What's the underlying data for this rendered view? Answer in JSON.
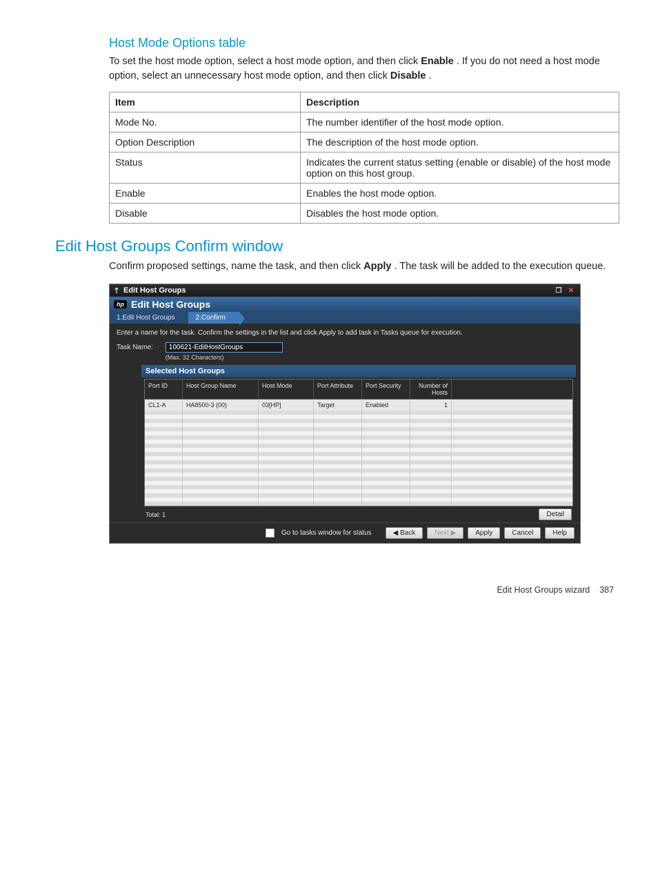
{
  "section1": {
    "heading": "Host Mode Options table",
    "intro_pre": "To set the host mode option, select a host mode option, and then click ",
    "intro_b1": "Enable",
    "intro_mid": ". If you do not need a host mode option, select an unnecessary host mode option, and then click ",
    "intro_b2": "Disable",
    "intro_post": "."
  },
  "opts_table": {
    "head_item": "Item",
    "head_desc": "Description",
    "rows": [
      {
        "item": "Mode No.",
        "desc": "The number identifier of the host mode option."
      },
      {
        "item": "Option Description",
        "desc": "The description of the host mode option."
      },
      {
        "item": "Status",
        "desc": "Indicates the current status setting (enable or disable) of the host mode option on this host group."
      },
      {
        "item": "Enable",
        "desc": "Enables the host mode option."
      },
      {
        "item": "Disable",
        "desc": "Disables the host mode option."
      }
    ]
  },
  "section2": {
    "heading": "Edit Host Groups Confirm window",
    "intro_pre": "Confirm proposed settings, name the task, and then click ",
    "intro_b1": "Apply",
    "intro_post": ". The task will be added to the execution queue."
  },
  "modal": {
    "title": "Edit Host Groups",
    "header": "Edit Host Groups",
    "tabs": {
      "t1": "1.Edit Host Groups",
      "t2": "2.Confirm"
    },
    "instruction": "Enter a name for the task. Confirm the settings in the list and click Apply to add task in Tasks queue for execution.",
    "task_label": "Task Name:",
    "task_value": "100621-EditHostGroups",
    "task_note": "(Max. 32 Characters)",
    "panel_title": "Selected Host Groups",
    "columns": {
      "port_id": "Port ID",
      "hg_name": "Host Group Name",
      "host_mode": "Host Mode",
      "port_attr": "Port Attribute",
      "port_sec": "Port Security",
      "num_hosts": "Number of Hosts"
    },
    "row": {
      "port_id": "CL1-A",
      "hg_name": "HA8500-3 (00)",
      "host_mode": "03[HP]",
      "port_attr": "Target",
      "port_sec": "Enabled",
      "num_hosts": "1"
    },
    "total_label": "Total:  1",
    "detail_btn": "Detail",
    "footer": {
      "checkbox_label": "Go to tasks window for status",
      "back": "◀ Back",
      "next": "Next ▶",
      "apply": "Apply",
      "cancel": "Cancel",
      "help": "Help"
    }
  },
  "page_footer": {
    "text": "Edit Host Groups wizard",
    "page": "387"
  }
}
